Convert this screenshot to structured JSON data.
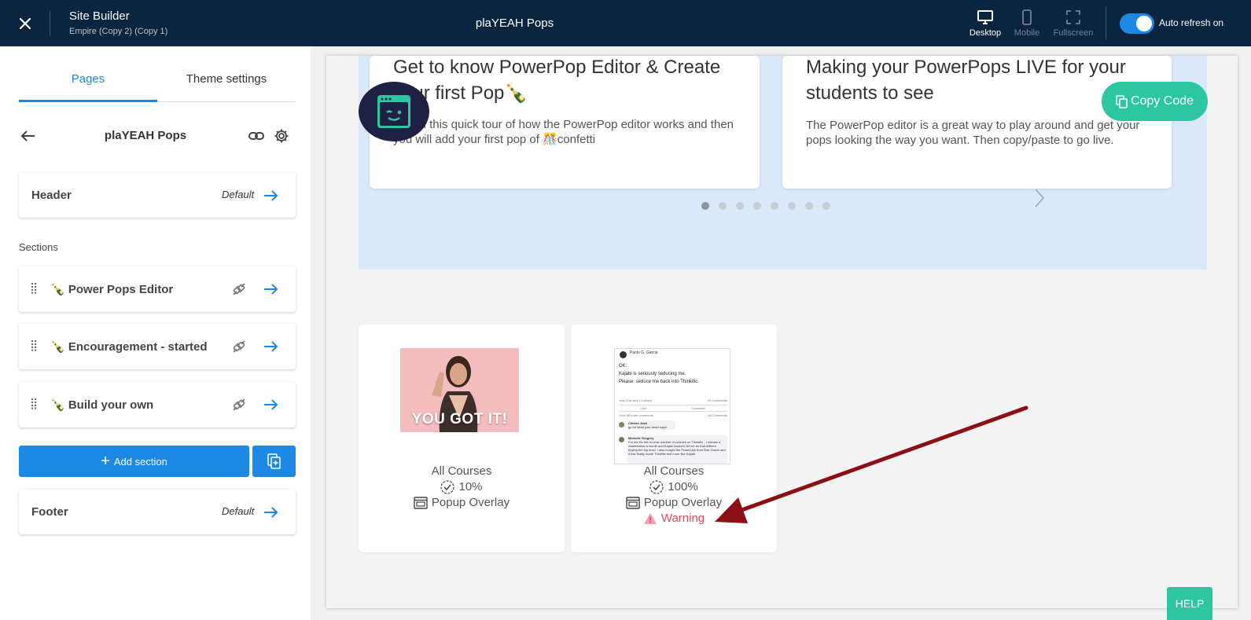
{
  "topbar": {
    "title": "Site Builder",
    "subtitle": "Empire (Copy 2) (Copy 1)",
    "page_name": "plaYEAH Pops",
    "views": [
      {
        "label": "Desktop",
        "icon": "desktop-icon"
      },
      {
        "label": "Mobile",
        "icon": "mobile-icon"
      },
      {
        "label": "Fullscreen",
        "icon": "fullscreen-icon"
      }
    ],
    "auto_refresh_label": "Auto refresh on",
    "auto_refresh_on": true
  },
  "sidebar": {
    "tabs": [
      "Pages",
      "Theme settings"
    ],
    "page_title": "plaYEAH Pops",
    "header": {
      "label": "Header",
      "tag": "Default"
    },
    "sections_label": "Sections",
    "sections": [
      {
        "label": "🍾 Power Pops Editor"
      },
      {
        "label": "🍾 Encouragement - started"
      },
      {
        "label": "🍾 Build your own"
      }
    ],
    "add_section_label": "Add section",
    "footer": {
      "label": "Footer",
      "tag": "Default"
    }
  },
  "preview": {
    "slides": [
      {
        "title": "Get to know PowerPop Editor & Create your first Pop🍾",
        "body": "Watch this quick tour of how the PowerPop editor works and then you will add your first pop of 🎊confetti"
      },
      {
        "title": "Making your PowerPops LIVE for your students to see",
        "body": "The PowerPop editor is a great way to play around and get your pops looking the way you want. Then copy/paste to go live."
      }
    ],
    "dot_count": 8,
    "active_dot": 0,
    "copy_code_label": "Copy Code",
    "pops": [
      {
        "image_caption": "YOU GOT IT!",
        "audience": "All Courses",
        "progress": "10%",
        "type": "Popup Overlay",
        "warning": ""
      },
      {
        "image_caption": "",
        "audience": "All Courses",
        "progress": "100%",
        "type": "Popup Overlay",
        "warning": "Warning"
      }
    ],
    "post_thumb": {
      "author": "Paolo G. Garcia",
      "line1": "OK:",
      "line2": "Kajabi is seriously seducing me.",
      "line3": "Please: seduce me back into Thinkific.",
      "reactions": "Jean Pak and 13 others",
      "comments_count": "63 Comments",
      "like": "Like",
      "comment": "Comment",
      "view_more": "View 58 more comments",
      "all_comments": "All Comments",
      "c1_name": "Clinton Josh",
      "c1_text": "go for what your heart says!",
      "c2_name": "Michelle Gregory",
      "c2_text": "For me it's the no-max number of courses on Thinkific - I release a masterclass a month and Kajabi wouldn't let me do that without buying the top level. I also bought the PowerUps from Rob Galvin and it has finally made Thinkific feel more like Kajabi"
    }
  },
  "help_label": "HELP",
  "colors": {
    "topbar": "#0a2540",
    "accent": "#1e88e5",
    "teal": "#2cc6a0",
    "warning": "#e0465f",
    "annotation_arrow": "#8b0f14"
  }
}
